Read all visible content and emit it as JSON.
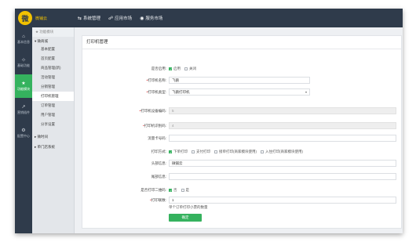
{
  "header": {
    "brand": "微铺云",
    "nav": [
      {
        "label": "系统管理",
        "icon": "share-icon"
      },
      {
        "label": "应用市场",
        "icon": "people-icon"
      },
      {
        "label": "服务市场",
        "icon": "globe-icon"
      }
    ]
  },
  "leftbar": [
    {
      "label": "基本信息",
      "icon": "home-icon"
    },
    {
      "label": "基础功能",
      "icon": "sitemap-icon"
    },
    {
      "label": "功能模块",
      "icon": "star-icon",
      "active": true
    },
    {
      "label": "营销插件",
      "icon": "chart-icon"
    },
    {
      "label": "配置中心",
      "icon": "gear-icon"
    }
  ],
  "subnav": {
    "favorites": "★ 功能模块",
    "group1": "▾ 微商城",
    "items": [
      "基本配置",
      "首页配置",
      "商品管理(新)",
      "活动管理",
      "分销管理",
      "打印机管理",
      "订单管理",
      "用户管理",
      "分享设置"
    ],
    "active_index": 5,
    "group2": "▸ 微时间",
    "group3": "▸ 单门店系统"
  },
  "page": {
    "title": "打印机管理",
    "fields": {
      "enabled": {
        "label": "是否启用:",
        "options": [
          "启用",
          "关闭"
        ],
        "checked": [
          true,
          false
        ]
      },
      "name": {
        "label": "打印机名称:",
        "value": "飞鹅",
        "required": true
      },
      "type": {
        "label": "打印机类型:",
        "value": "飞鹅打印机",
        "required": true
      },
      "device_id": {
        "label": "打印机设备编码:",
        "value": "5",
        "required": true
      },
      "device_key": {
        "label": "打印机识别码:",
        "value": "4",
        "required": true
      },
      "sim": {
        "label": "流量卡号码:",
        "value": ""
      },
      "mode": {
        "label": "打印方式:",
        "options": [
          "下单打印",
          "支付打印",
          "接单打印(商家模块使用)",
          "入住打印(商家模块使用)"
        ],
        "checked": [
          true,
          false,
          false,
          false
        ]
      },
      "header": {
        "label": "头部信息:",
        "value": "微铺云"
      },
      "footer": {
        "label": "尾部信息:",
        "value": ""
      },
      "qrcode": {
        "label": "是否打印二维码:",
        "options": [
          "否",
          "是"
        ],
        "checked": [
          true,
          false
        ]
      },
      "copies": {
        "label": "打印联数:",
        "value": "1",
        "required": true,
        "hint": "单个订单打印小票的数量"
      }
    },
    "submit_label": "确定"
  }
}
